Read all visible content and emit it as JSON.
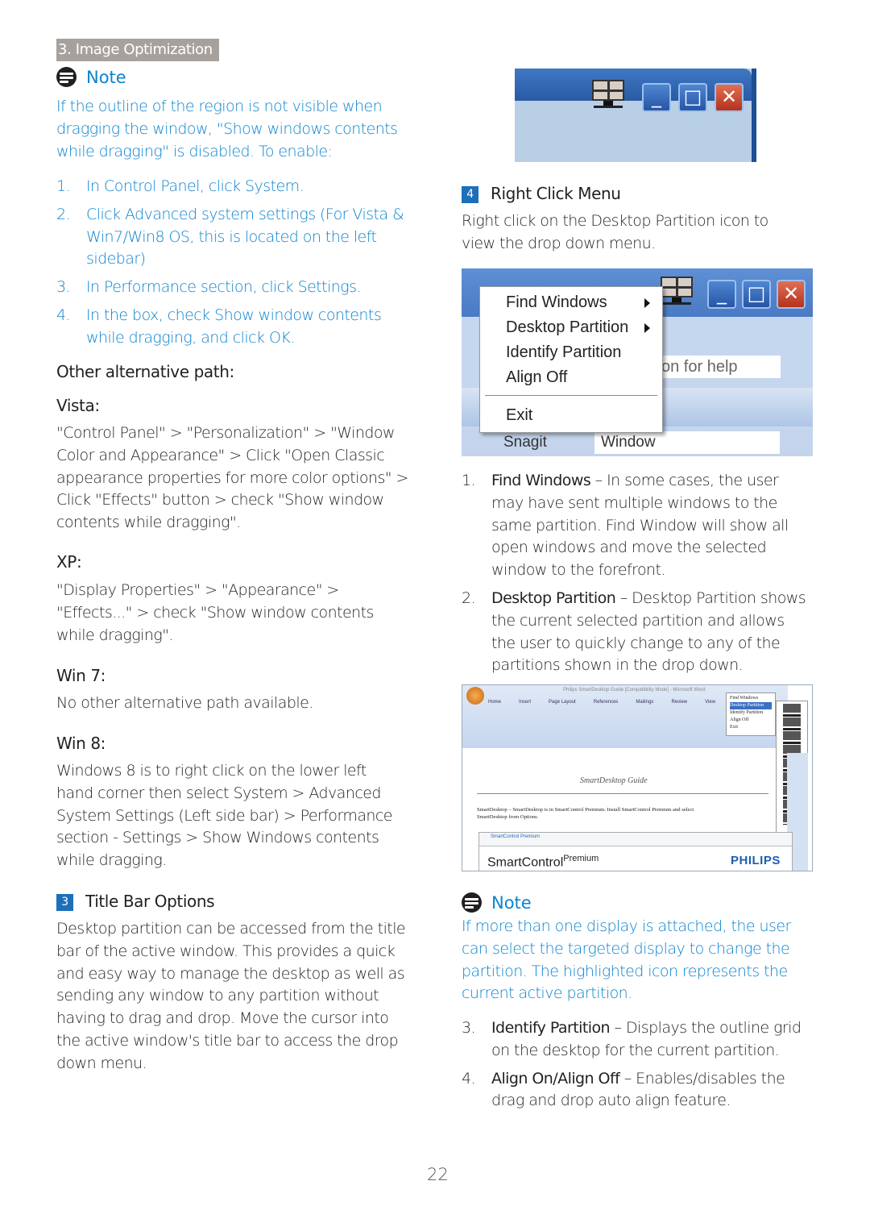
{
  "section_header": "3. Image Optimization",
  "colors": {
    "note_blue": "#0b83cf",
    "section_badge": "#1d6fb8",
    "header_gray": "#a7a19e"
  },
  "left": {
    "note": {
      "label": "Note",
      "icon": "note-icon",
      "text": "If the outline of the region is not visible when dragging the window, \"Show windows contents while dragging\" is disabled. To enable:",
      "steps": [
        {
          "n": "1.",
          "text": "In Control Panel, click System."
        },
        {
          "n": "2.",
          "text": "Click Advanced system settings (For Vista & Win7/Win8 OS, this is located on the left sidebar)"
        },
        {
          "n": "3.",
          "text": "In Performance section, click Settings."
        },
        {
          "n": "4.",
          "text": "In the box, check Show window contents while dragging, and click OK."
        }
      ]
    },
    "alt_heading": "Other alternative path:",
    "vista_label": "Vista:",
    "vista_text": "\"Control Panel\" > \"Personalization\" > \"Window Color and Appearance\" > Click \"Open Classic appearance properties for more color options\" > Click \"Effects\" button > check \"Show window contents while dragging\".",
    "xp_label": "XP:",
    "xp_text": "\"Display Properties\" > \"Appearance\" > \"Effects...\" > check \"Show window contents while dragging\".",
    "win7_label": "Win 7:",
    "win7_text": "No other alternative path available.",
    "win8_label": "Win 8:",
    "win8_text": "Windows 8 is to right click on the lower left hand corner then select System > Advanced System Settings (Left side bar) > Performance section - Settings > Show Windows contents while dragging.",
    "section3": {
      "num": "3",
      "title": "Title Bar Options",
      "text": "Desktop partition can be accessed from the title bar of the active window. This provides a quick and easy way to manage the desktop as well as sending any window to any partition without having to drag and drop. Move the cursor into the active window's title bar to access the drop down menu."
    }
  },
  "right": {
    "section4": {
      "num": "4",
      "title": "Right Click Menu",
      "text": "Right click on the Desktop Partition icon to view the drop down menu."
    },
    "menu_screenshot": {
      "items": [
        "Find Windows",
        "Desktop Partition",
        "Identify Partition",
        "Align Off",
        "Exit"
      ],
      "help_text": "on for help",
      "toolbar_items": [
        "Snagit",
        "Window"
      ]
    },
    "features_a": [
      {
        "n": "1.",
        "term": "Find Windows",
        "text": " – In some cases, the user may have sent multiple windows to the same partition. Find Window will show all open windows and move the selected window to the forefront."
      },
      {
        "n": "2.",
        "term": "Desktop Partition",
        "text": " – Desktop Partition shows the current selected partition and allows the user to quickly change to any of the partitions shown in the drop down."
      }
    ],
    "word_screenshot": {
      "title": "Philips SmartDesktop Guide [Compatibility Mode] - Microsoft Word",
      "tabs": [
        "Home",
        "Insert",
        "Page Layout",
        "References",
        "Mailings",
        "Review",
        "View"
      ],
      "menu_items": [
        "Find Windows",
        "Desktop Partition",
        "Identify Partition",
        "Align Off",
        "Exit"
      ],
      "doc_title": "SmartDesktop Guide",
      "doc_line1": "SmartDesktop – SmartDesktop is in SmartControl Premium. Install SmartControl Premium and select",
      "doc_line2": "SmartDesktop from Options.",
      "dialog_title": "SmartControl Premium",
      "brand_main": "SmartControl",
      "brand_sup": "Premium",
      "logo": "PHILIPS"
    },
    "note": {
      "label": "Note",
      "text": "If more than one display is attached, the user can select the targeted display to change the partition. The highlighted icon represents the current active partition."
    },
    "features_b": [
      {
        "n": "3.",
        "term": "Identify Partition",
        "text": " – Displays the outline grid on the desktop for the current partition."
      },
      {
        "n": "4.",
        "term": "Align On/Align Off",
        "text": " – Enables/disables the drag and drop auto align feature."
      }
    ]
  },
  "page_number": "22"
}
